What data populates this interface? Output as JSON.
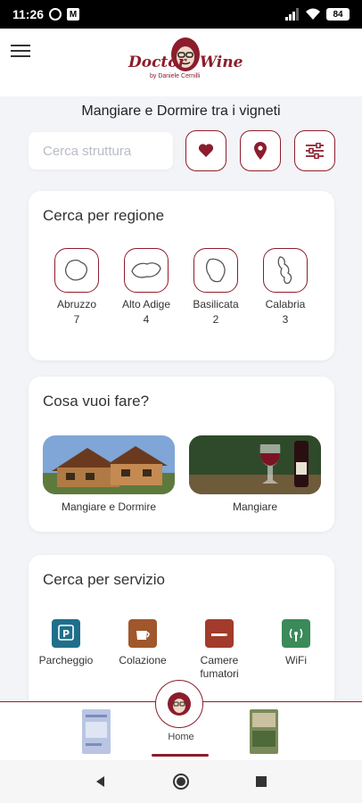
{
  "statusbar": {
    "time": "11:26",
    "battery": "84"
  },
  "header": {
    "logo_word1": "Doctor",
    "logo_word2": "Wine",
    "logo_sub": "by Daniele Cernilli"
  },
  "subtitle": "Mangiare e Dormire tra i vigneti",
  "search": {
    "placeholder": "Cerca struttura"
  },
  "action_icons": [
    "heart-icon",
    "location-pin-icon",
    "sliders-icon"
  ],
  "regions": {
    "title": "Cerca per regione",
    "items": [
      {
        "name": "Abruzzo",
        "count": "7"
      },
      {
        "name": "Alto Adige",
        "count": "4"
      },
      {
        "name": "Basilicata",
        "count": "2"
      },
      {
        "name": "Calabria",
        "count": "3"
      }
    ]
  },
  "activities": {
    "title": "Cosa vuoi fare?",
    "items": [
      {
        "label": "Mangiare e Dormire"
      },
      {
        "label": "Mangiare"
      }
    ]
  },
  "services": {
    "title": "Cerca per servizio",
    "items": [
      {
        "label": "Parcheggio",
        "color": "#1f6f8b"
      },
      {
        "label": "Colazione",
        "color": "#a0572b"
      },
      {
        "label": "Camere fumatori",
        "color": "#a23b2b"
      },
      {
        "label": "WiFi",
        "color": "#3b8a5a"
      }
    ]
  },
  "bottomnav": {
    "home_label": "Home"
  },
  "colors": {
    "brand": "#8b1d2c"
  }
}
